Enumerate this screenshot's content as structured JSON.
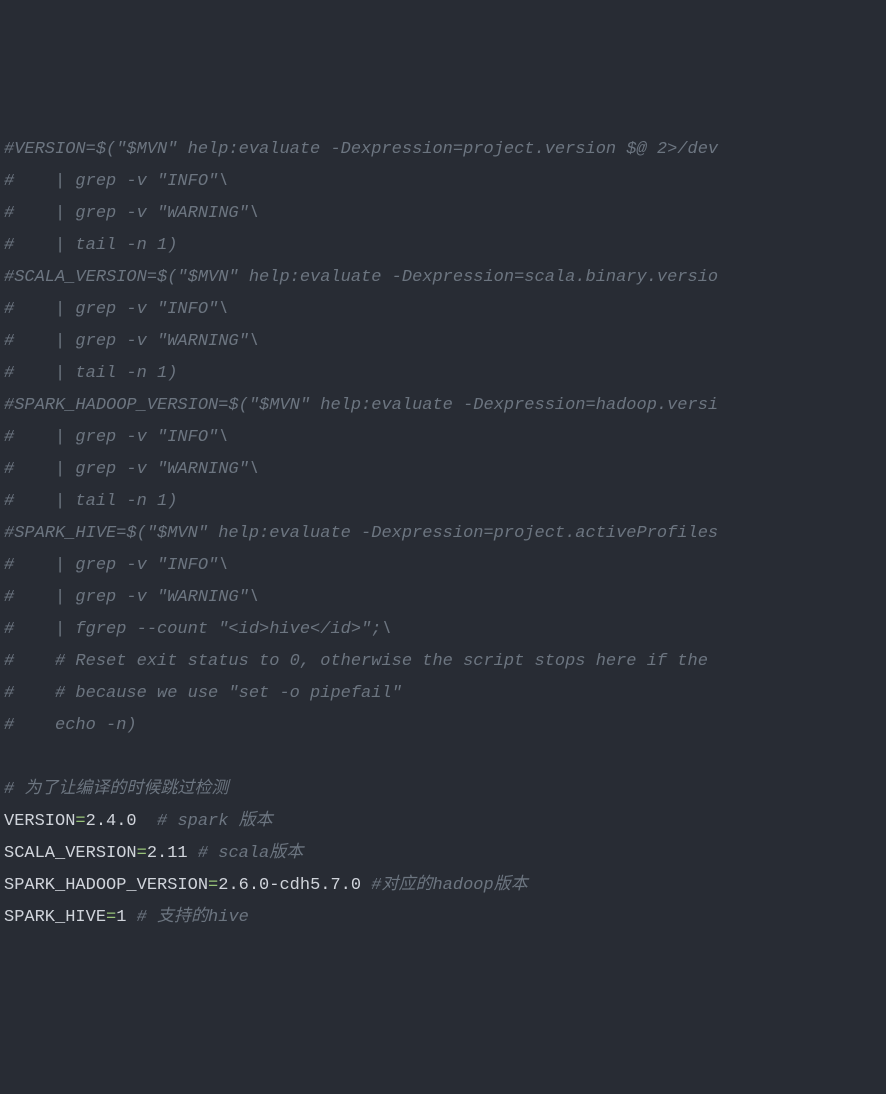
{
  "lines": [
    {
      "type": "comment",
      "text": "#VERSION=$(\"$MVN\" help:evaluate -Dexpression=project.version $@ 2>/dev"
    },
    {
      "type": "comment",
      "text": "#    | grep -v \"INFO\"\\"
    },
    {
      "type": "comment",
      "text": "#    | grep -v \"WARNING\"\\"
    },
    {
      "type": "comment",
      "text": "#    | tail -n 1)"
    },
    {
      "type": "comment",
      "text": "#SCALA_VERSION=$(\"$MVN\" help:evaluate -Dexpression=scala.binary.versio"
    },
    {
      "type": "comment",
      "text": "#    | grep -v \"INFO\"\\"
    },
    {
      "type": "comment",
      "text": "#    | grep -v \"WARNING\"\\"
    },
    {
      "type": "comment",
      "text": "#    | tail -n 1)"
    },
    {
      "type": "comment",
      "text": "#SPARK_HADOOP_VERSION=$(\"$MVN\" help:evaluate -Dexpression=hadoop.versi"
    },
    {
      "type": "comment",
      "text": "#    | grep -v \"INFO\"\\"
    },
    {
      "type": "comment",
      "text": "#    | grep -v \"WARNING\"\\"
    },
    {
      "type": "comment",
      "text": "#    | tail -n 1)"
    },
    {
      "type": "comment",
      "text": "#SPARK_HIVE=$(\"$MVN\" help:evaluate -Dexpression=project.activeProfiles"
    },
    {
      "type": "comment",
      "text": "#    | grep -v \"INFO\"\\"
    },
    {
      "type": "comment",
      "text": "#    | grep -v \"WARNING\"\\"
    },
    {
      "type": "comment",
      "text": "#    | fgrep --count \"<id>hive</id>\";\\"
    },
    {
      "type": "comment",
      "text": "#    # Reset exit status to 0, otherwise the script stops here if the "
    },
    {
      "type": "comment",
      "text": "#    # because we use \"set -o pipefail\""
    },
    {
      "type": "comment",
      "text": "#    echo -n)"
    },
    {
      "type": "blank",
      "text": ""
    },
    {
      "type": "comment",
      "text": "# 为了让编译的时候跳过检测"
    },
    {
      "type": "assign",
      "var": "VERSION",
      "val": "2.4.0",
      "trail": "  # spark 版本"
    },
    {
      "type": "assign",
      "var": "SCALA_VERSION",
      "val": "2.11",
      "trail": " # scala版本"
    },
    {
      "type": "assign",
      "var": "SPARK_HADOOP_VERSION",
      "val": "2.6.0-cdh5.7.0",
      "trail": " #对应的hadoop版本"
    },
    {
      "type": "assign",
      "var": "SPARK_HIVE",
      "val": "1",
      "trail": " # 支持的hive"
    }
  ]
}
